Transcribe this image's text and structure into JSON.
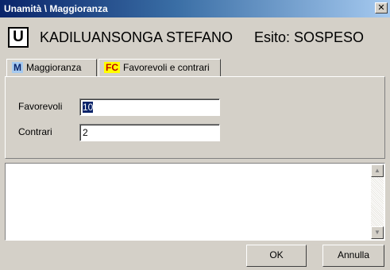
{
  "window": {
    "title": "Unamità \\ Maggioranza",
    "close_glyph": "✕"
  },
  "header": {
    "letter": "U",
    "name": "KADILUANSONGA STEFANO",
    "esito": "Esito: SOSPESO"
  },
  "tabs": [
    {
      "badge": "M",
      "label": "Maggioranza"
    },
    {
      "badge": "FC",
      "label": "Favorevoli e contrari"
    }
  ],
  "fields": {
    "favorevoli": {
      "label": "Favorevoli",
      "value": "10"
    },
    "contrari": {
      "label": "Contrari",
      "value": "2"
    }
  },
  "scrollbar": {
    "up": "▲",
    "down": "▼"
  },
  "buttons": {
    "ok": "OK",
    "cancel": "Annulla"
  }
}
